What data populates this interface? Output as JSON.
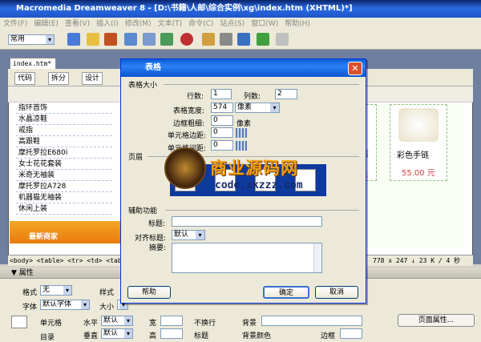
{
  "app": {
    "title": "Macromedia Dreamweaver 8 - [D:\\书籍\\人邮\\综合实例\\xg\\index.htm (XHTML)*]"
  },
  "menu": [
    "文件(F)",
    "编辑(E)",
    "查看(V)",
    "插入(I)",
    "修改(M)",
    "文本(T)",
    "命令(C)",
    "站点(S)",
    "窗口(W)",
    "帮助(H)"
  ],
  "toolbar": {
    "category": "常用"
  },
  "document": {
    "tab": "index.htm*",
    "views": {
      "code": "代码",
      "split": "拆分",
      "design": "设计"
    },
    "list_items": [
      "指环首饰",
      "水晶凉鞋",
      "戒指",
      "高跟鞋",
      "摩托罗拉E680i",
      "女士花花套装",
      "米奇无袖装",
      "摩托罗拉A728",
      "机器猫无袖装",
      "休闲上装"
    ],
    "banner": "最新商家",
    "product": {
      "name": "彩色手链",
      "price": "55.00 元",
      "left_fragment": "信",
      "left_price_fragment": "元"
    },
    "status_tags": "<body> <table> <tr> <td> <table>",
    "status_right": "778 x 247 ↓ 23 K / 4 秒"
  },
  "properties": {
    "header": "▼ 属性",
    "format_label": "格式",
    "format_value": "无",
    "style_label": "样式",
    "font_label": "字体",
    "font_value": "默认字体",
    "size_label": "大小",
    "size_value": "无",
    "cell_label": "单元格",
    "horz_label": "水平",
    "horz_value": "默认",
    "vert_label": "垂直",
    "vert_value": "默认",
    "width_label": "宽",
    "height_label": "高",
    "nowrap_label": "不换行",
    "header_label": "标题",
    "bg_label": "背景",
    "bg_color_label": "背景颜色",
    "border_label": "边框",
    "page_props_button": "页面属性...",
    "cell_sub": "目录"
  },
  "dialog": {
    "title": "表格",
    "table_size_group": "表格大小",
    "rows_label": "行数:",
    "rows_value": "1",
    "cols_label": "列数:",
    "cols_value": "2",
    "width_label": "表格宽度:",
    "width_value": "574",
    "width_unit": "像素",
    "border_label": "边框粗细:",
    "border_value": "0",
    "border_unit": "像素",
    "padding_label": "单元格边距:",
    "padding_value": "0",
    "spacing_label": "单元格间距:",
    "spacing_value": "0",
    "header_group": "页眉",
    "access_group": "辅助功能",
    "caption_label": "标题:",
    "align_label": "对齐标题:",
    "align_value": "默认",
    "summary_label": "摘要:",
    "help_button": "帮助",
    "ok_button": "确定",
    "cancel_button": "取消"
  },
  "watermark": {
    "text": "商业源码网",
    "url": "code.xkzzz.com"
  }
}
